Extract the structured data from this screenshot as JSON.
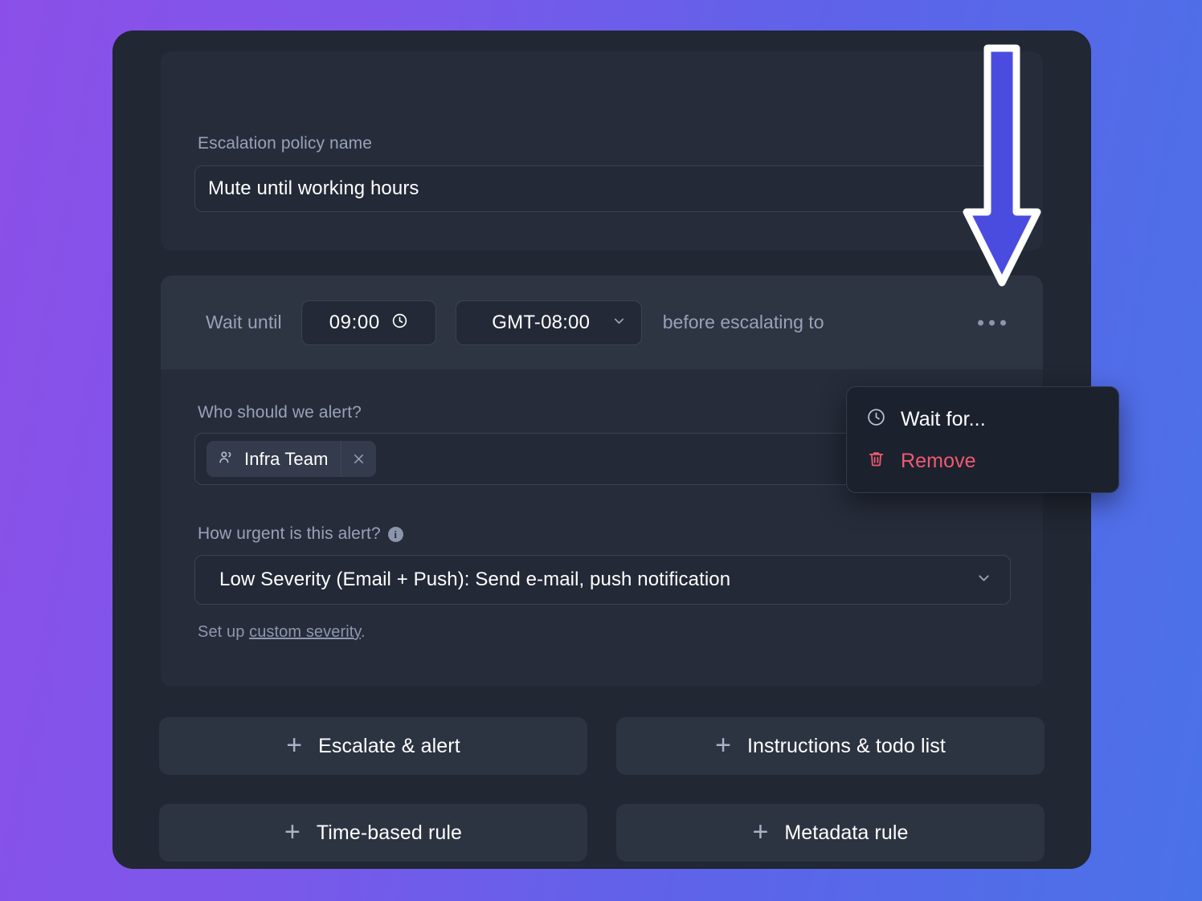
{
  "theme": {
    "bg_gradient_from": "#8b4fe8",
    "bg_gradient_to": "#4a72e8",
    "card_bg": "#212733",
    "panel_bg": "#262c3a",
    "panel_header_bg": "#2d3442",
    "input_bg": "#232936",
    "text_primary": "#ffffff",
    "text_muted": "#98a2b8",
    "danger": "#ef5a6f",
    "annotation_arrow": "#4a4ce0"
  },
  "policy": {
    "name_label": "Escalation policy name",
    "name_value": "Mute until working hours",
    "name_placeholder": "Escalation policy name"
  },
  "rule": {
    "wait_label": "Wait until",
    "time_value": "09:00",
    "time_icon": "clock-icon",
    "timezone_value": "GMT-08:00",
    "timezone_chevron": "chevron-down-icon",
    "after_label": "before escalating to",
    "kebab_icon": "ellipsis-horizontal-icon"
  },
  "alert": {
    "who_label": "Who should we alert?",
    "team_tag": {
      "icon": "users-icon",
      "label": "Infra Team",
      "remove_icon": "close-icon"
    },
    "who_chevron": "chevron-down-icon",
    "urgency_label": "How urgent is this alert?",
    "urgency_info_icon": "info-icon",
    "urgency_value": "Low Severity (Email + Push): Send e-mail, push notification",
    "urgency_chevron": "chevron-down-icon",
    "custom_severity_prefix": "Set up ",
    "custom_severity_link": "custom severity",
    "custom_severity_suffix": "."
  },
  "menu": {
    "items": [
      {
        "label": "Wait for...",
        "icon": "clock-icon",
        "variant": "default"
      },
      {
        "label": "Remove",
        "icon": "trash-icon",
        "variant": "danger"
      }
    ]
  },
  "actions": {
    "plus_icon": "plus-icon",
    "buttons": [
      {
        "label": "Escalate & alert"
      },
      {
        "label": "Instructions & todo list"
      },
      {
        "label": "Time-based rule"
      },
      {
        "label": "Metadata rule"
      }
    ]
  },
  "annotation": {
    "arrow_icon": "down-arrow-annotation",
    "points_to": "ellipsis-horizontal-icon"
  }
}
